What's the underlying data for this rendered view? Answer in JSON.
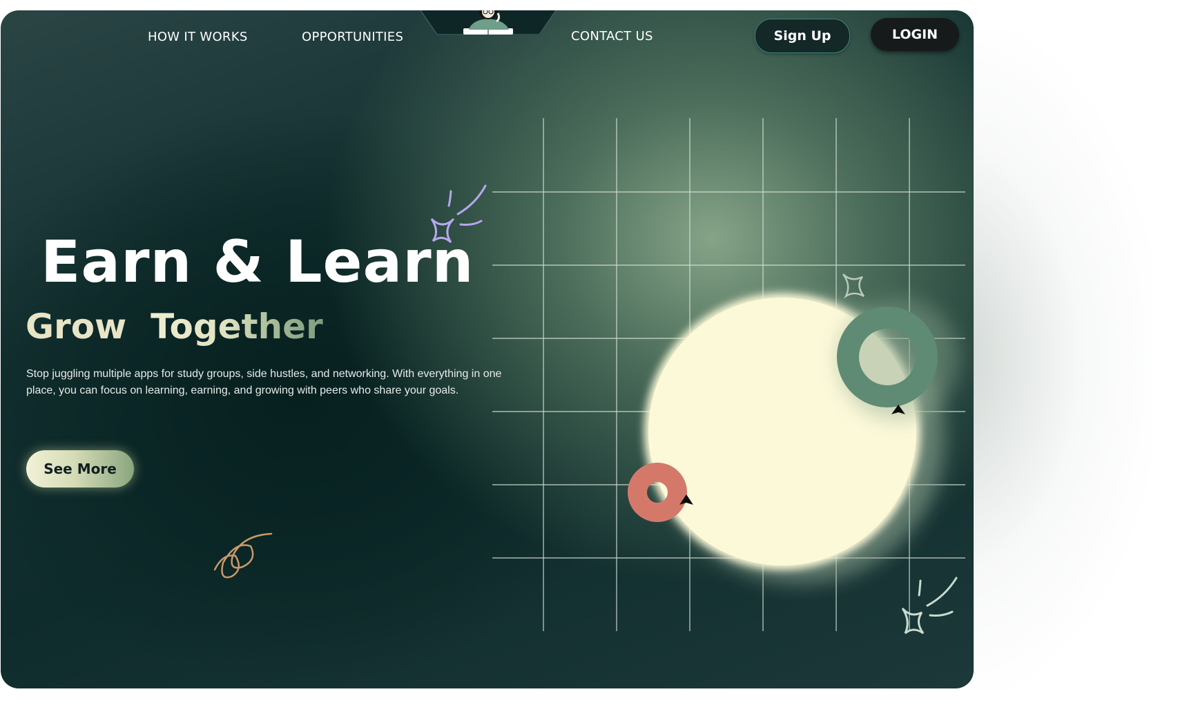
{
  "nav": {
    "links": [
      {
        "label": "HOW IT WORKS"
      },
      {
        "label": "OPPORTUNITIES"
      },
      {
        "label": "CONTACT US"
      }
    ],
    "signup_label": "Sign Up",
    "login_label": "LOGIN"
  },
  "hero": {
    "title": "Earn & Learn",
    "subtitle_part1": "Grow",
    "subtitle_part2": "Together",
    "description": "Stop juggling multiple apps for study groups, side hustles, and networking. With everything in one place, you can focus on learning, earning, and growing with peers who share your goals.",
    "cta_label": "See More"
  },
  "colors": {
    "background_dark": "#0f2c2c",
    "accent_green": "#5f8a74",
    "cream": "#fdf9d8",
    "coral": "#d4796a",
    "lavender": "#b6a8ee",
    "tan": "#c99a6a"
  },
  "icons": [
    "avatar-illustration",
    "sparkle-icon",
    "swirl-icon",
    "cursor-icon"
  ]
}
